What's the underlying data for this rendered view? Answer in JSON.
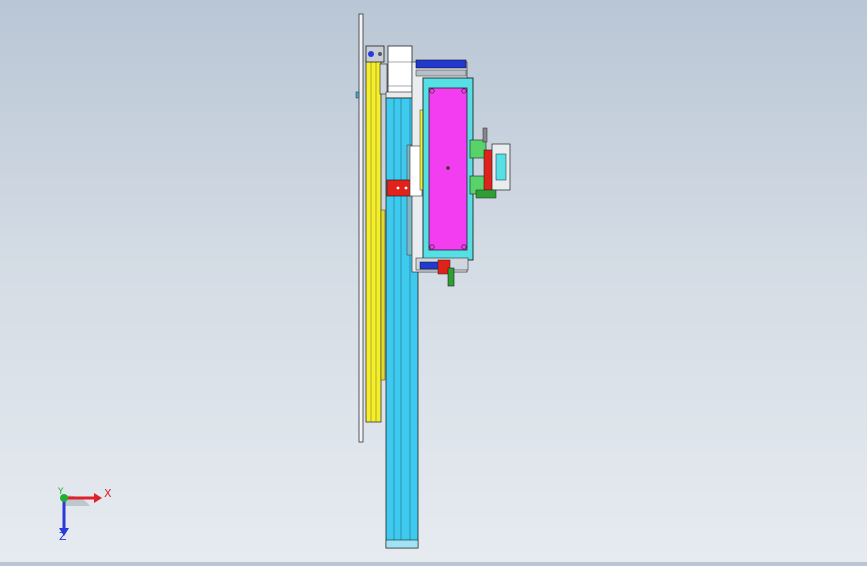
{
  "viewport": {
    "background_top": "#b9c6d5",
    "background_bottom": "#e6ebf0"
  },
  "triad": {
    "x_label": "X",
    "y_label": "Y",
    "z_label": "Z",
    "x_color": "#e0202a",
    "y_color": "#22b032",
    "z_color": "#2a3ad8"
  },
  "model": {
    "colors": {
      "panel": "#f2f4f6",
      "rail": "#f5ee2a",
      "profile": "#3ec9ee",
      "carriage": "#56e0e6",
      "plate": "#f23ef0",
      "motor": "#ffffff",
      "stopper": "#e1221b",
      "bracket": "#2f9e35",
      "fitting": "#58d36a",
      "clamp": "#2239d1"
    }
  }
}
